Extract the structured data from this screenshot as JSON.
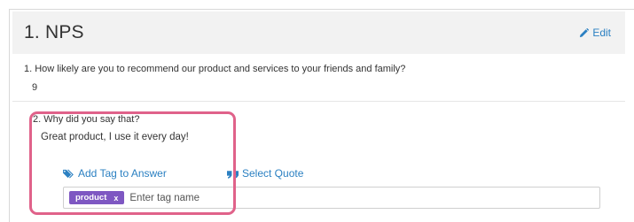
{
  "section": {
    "title": "1. NPS",
    "edit_label": "Edit"
  },
  "questions": [
    {
      "label": "1. How likely are you to recommend our product and services to your friends and family?",
      "answer": "9"
    },
    {
      "label": "2. Why did you say that?",
      "answer": "Great product, I use it every day!"
    }
  ],
  "actions": {
    "add_tag_label": "Add Tag to Answer",
    "select_quote_label": "Select Quote"
  },
  "tag_input": {
    "tags": [
      {
        "label": "product",
        "remove_label": "x"
      }
    ],
    "placeholder": "Enter tag name"
  },
  "colors": {
    "link": "#2b80c2",
    "tag_chip": "#7e57c2",
    "highlight": "#e0628a",
    "header_bg": "#f2f2f2"
  },
  "icons": {
    "edit": "pencil-icon",
    "add_tag": "tag-icon",
    "select_quote": "quote-icon"
  }
}
